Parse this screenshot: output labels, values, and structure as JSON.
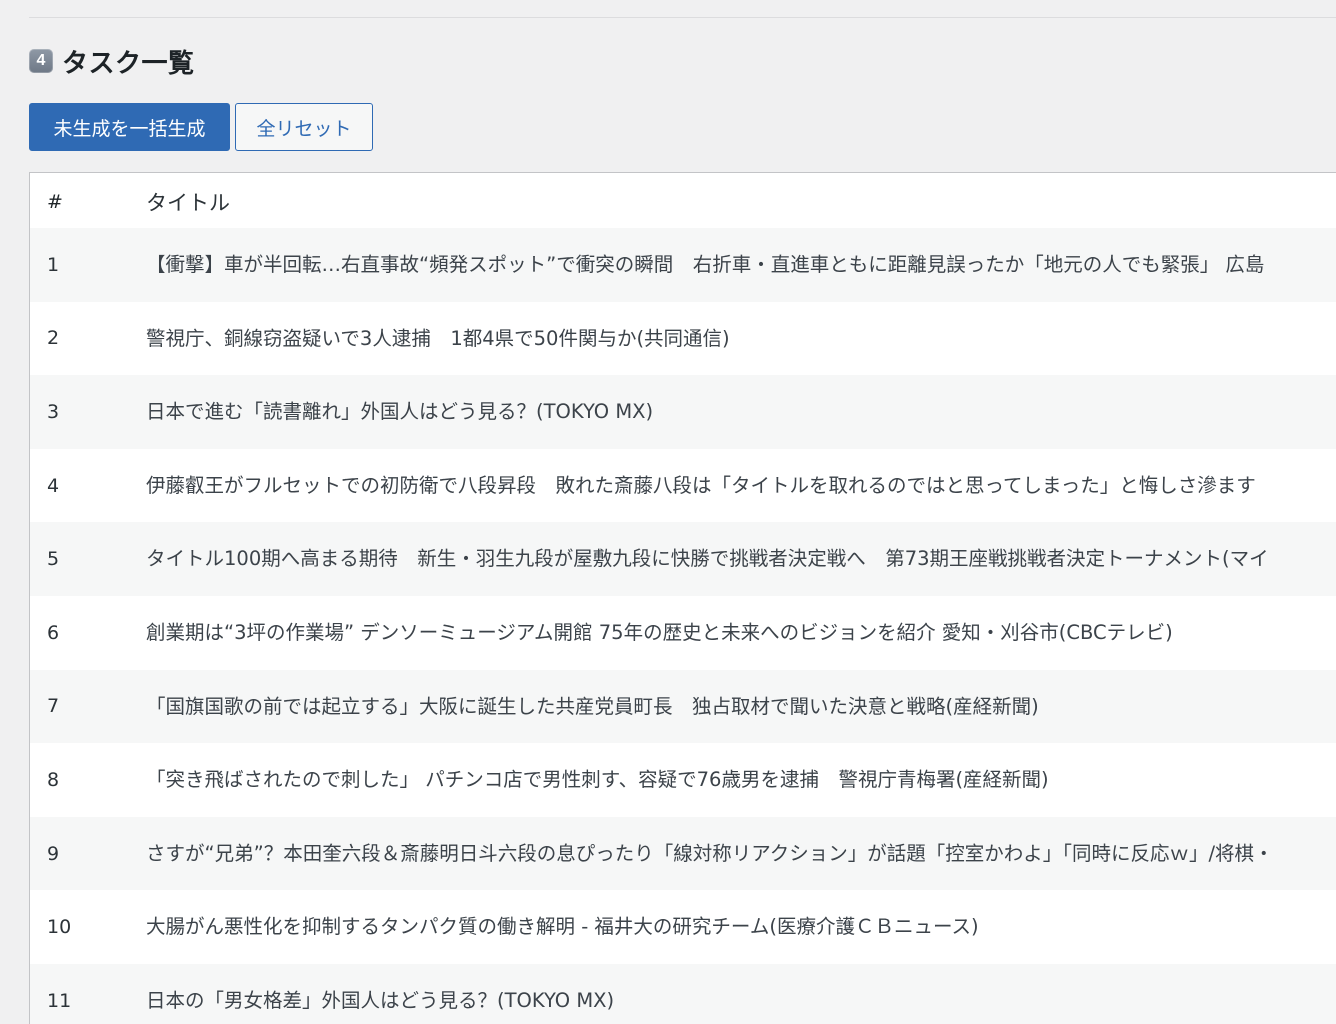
{
  "section": {
    "badge": "4",
    "title": "タスク一覧"
  },
  "toolbar": {
    "generate_label": "未生成を一括生成",
    "reset_label": "全リセット"
  },
  "table": {
    "columns": {
      "num": "#",
      "title": "タイトル"
    },
    "rows": [
      {
        "num": "1",
        "title": "【衝撃】車が半回転…右直事故“頻発スポット”で衝突の瞬間　右折車・直進車ともに距離見誤ったか「地元の人でも緊張」 広島"
      },
      {
        "num": "2",
        "title": "警視庁、銅線窃盗疑いで3人逮捕　1都4県で50件関与か(共同通信)"
      },
      {
        "num": "3",
        "title": "日本で進む「読書離れ」外国人はどう見る？(TOKYO MX)"
      },
      {
        "num": "4",
        "title": "伊藤叡王がフルセットでの初防衛で八段昇段　敗れた斎藤八段は「タイトルを取れるのではと思ってしまった」と悔しさ滲ます"
      },
      {
        "num": "5",
        "title": "タイトル100期へ高まる期待　新生・羽生九段が屋敷九段に快勝で挑戦者決定戦へ　第73期王座戦挑戦者決定トーナメント(マイ"
      },
      {
        "num": "6",
        "title": "創業期は“3坪の作業場” デンソーミュージアム開館 75年の歴史と未来へのビジョンを紹介 愛知・刈谷市(CBCテレビ)"
      },
      {
        "num": "7",
        "title": "「国旗国歌の前では起立する」大阪に誕生した共産党員町長　独占取材で聞いた決意と戦略(産経新聞)"
      },
      {
        "num": "8",
        "title": "「突き飛ばされたので刺した」 パチンコ店で男性刺す、容疑で76歳男を逮捕　警視庁青梅署(産経新聞)"
      },
      {
        "num": "9",
        "title": "さすが“兄弟”？本田奎六段＆斎藤明日斗六段の息ぴったり「線対称リアクション」が話題「控室かわよ」「同時に反応ｗ」/将棋・"
      },
      {
        "num": "10",
        "title": "大腸がん悪性化を抑制するタンパク質の働き解明 - 福井大の研究チーム(医療介護ＣＢニュース)"
      },
      {
        "num": "11",
        "title": "日本の「男女格差」外国人はどう見る？(TOKYO MX)"
      }
    ]
  }
}
